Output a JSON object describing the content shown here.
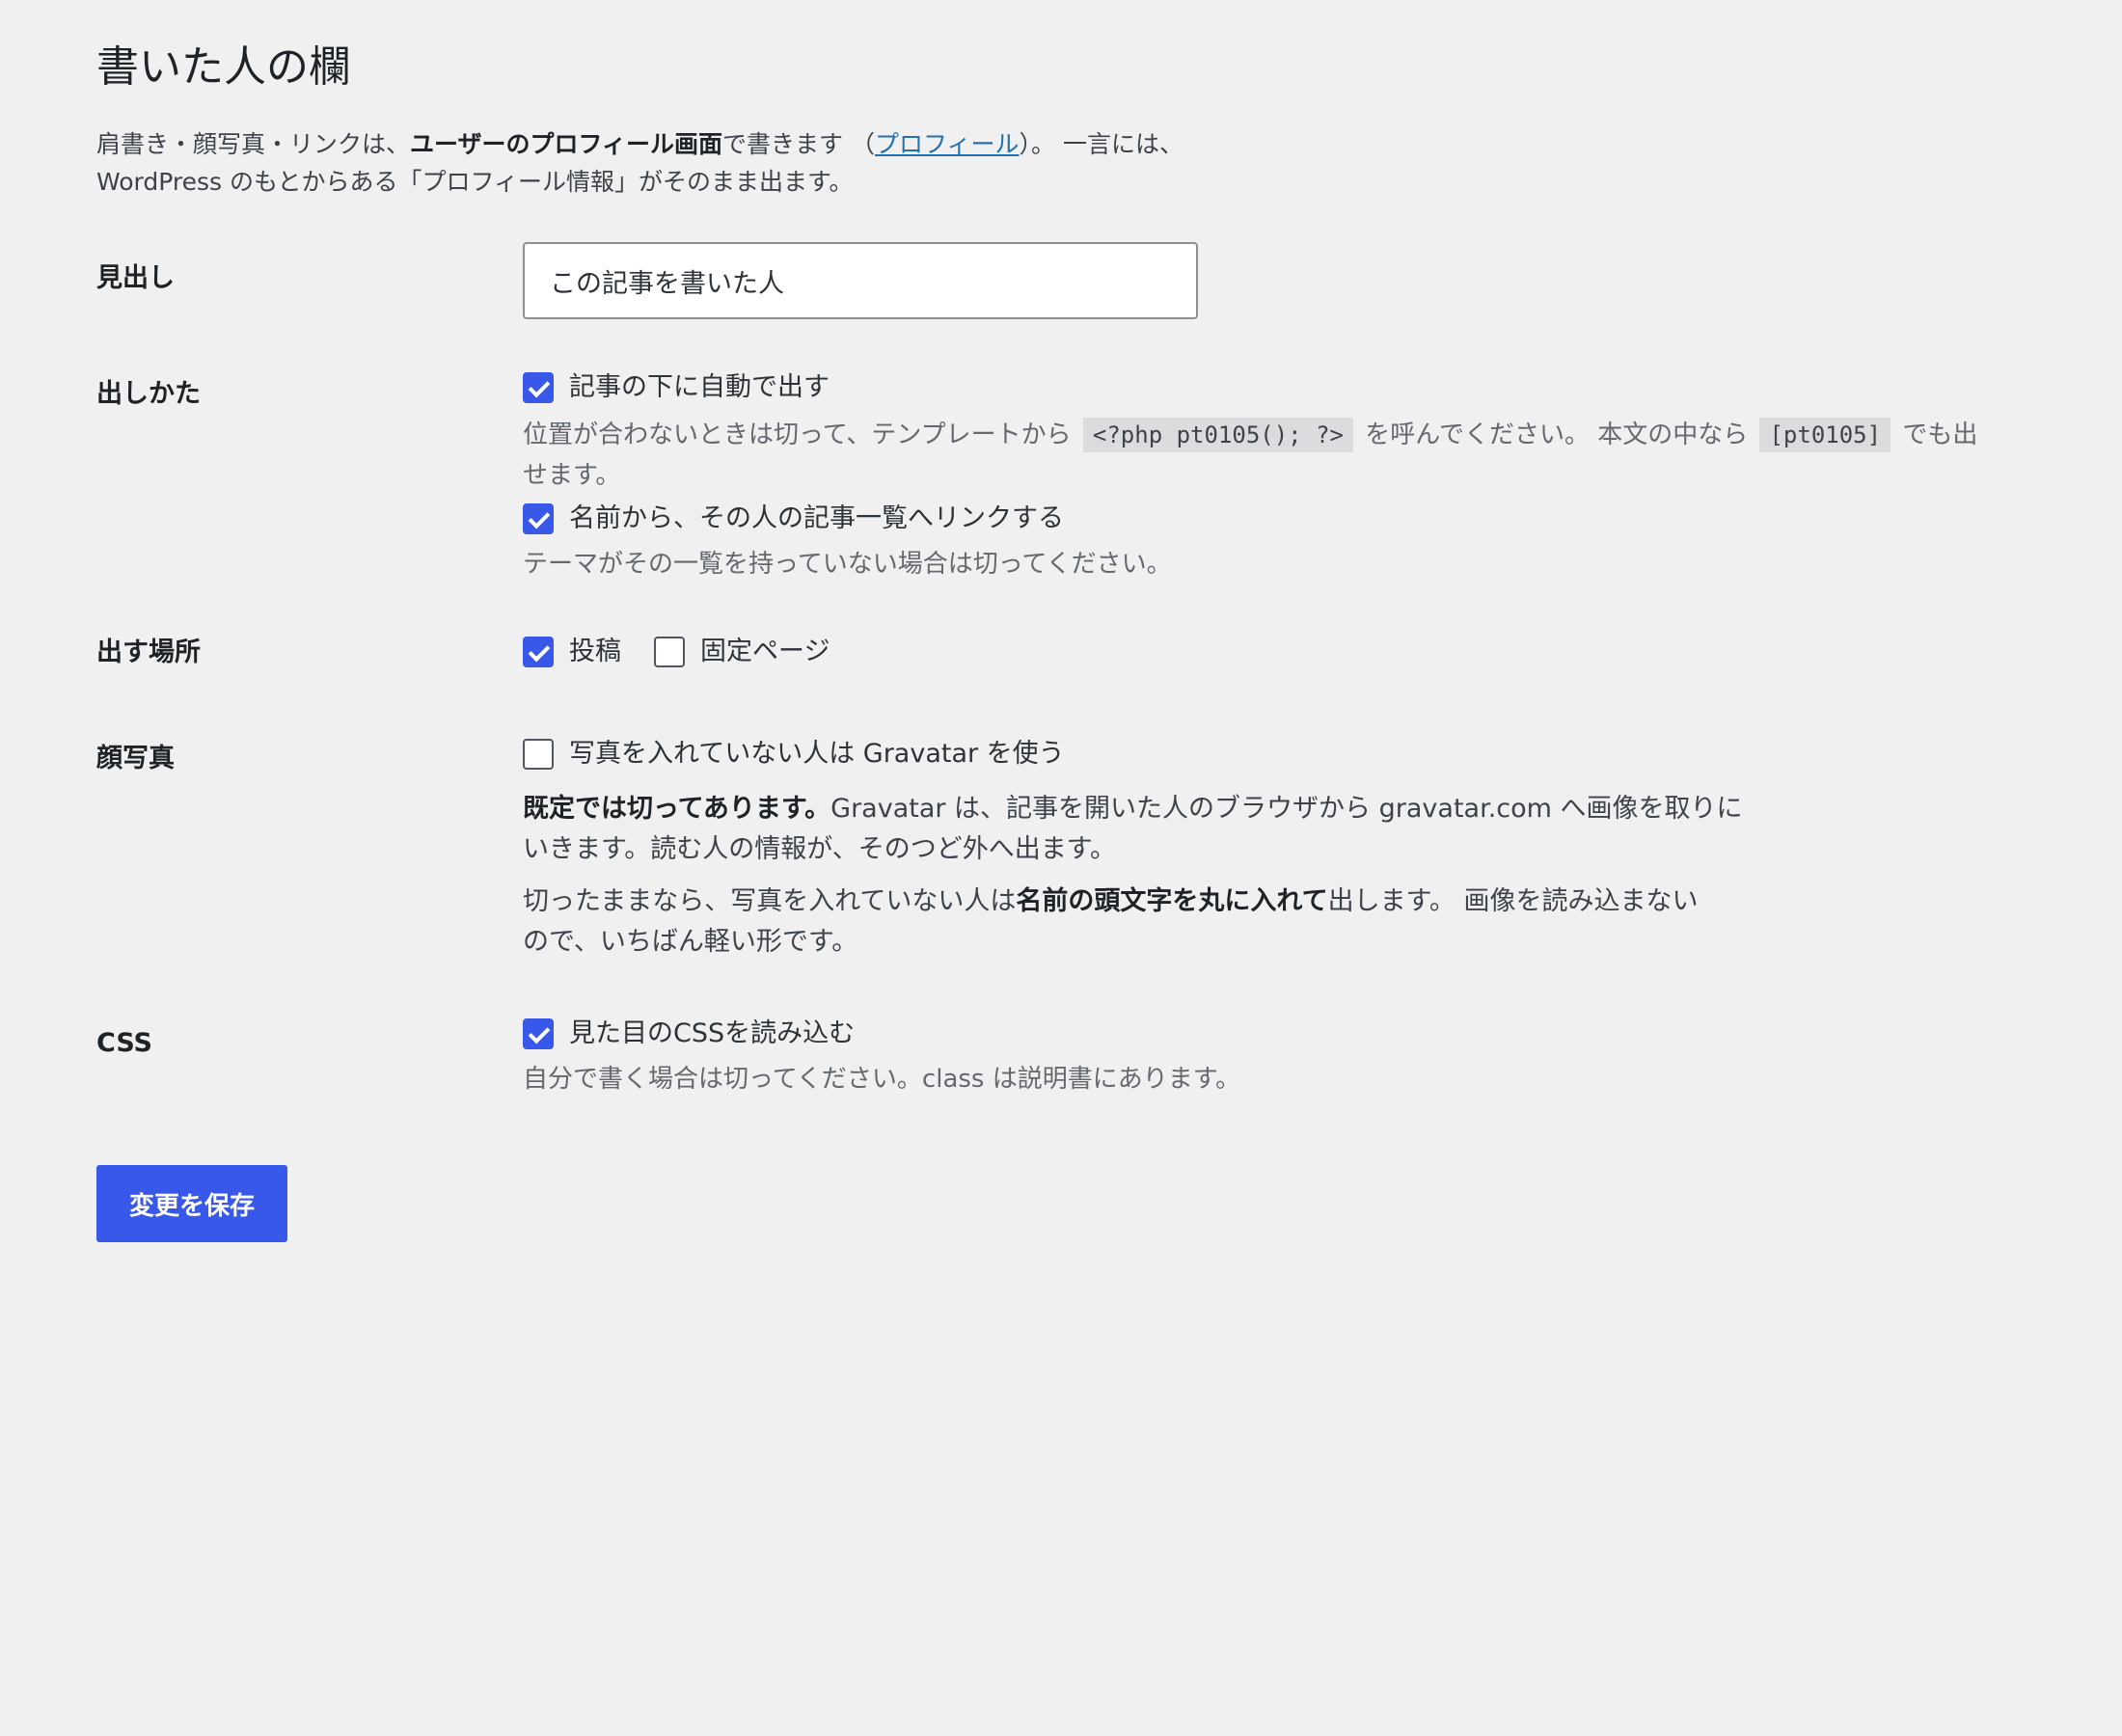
{
  "page_title": "書いた人の欄",
  "intro": {
    "part1": "肩書き・顔写真・リンクは、",
    "bold": "ユーザーのプロフィール画面",
    "part2": "で書きます （",
    "link": "プロフィール",
    "part3": "）。 一言には、",
    "line2": "WordPress のもとからある「プロフィール情報」がそのまま出ます。"
  },
  "heading_row": {
    "label": "見出し",
    "value": "この記事を書いた人"
  },
  "display_row": {
    "label": "出しかた",
    "auto_label": "記事の下に自動で出す",
    "auto_checked": true,
    "auto_desc_1": "位置が合わないときは切って、テンプレートから",
    "auto_code_1": "<?php pt0105(); ?>",
    "auto_desc_2": "を呼んでください。 本文の中なら",
    "auto_code_2": "[pt0105]",
    "auto_desc_3": "でも出",
    "auto_desc_4": "せます。",
    "link_label": "名前から、その人の記事一覧へリンクする",
    "link_checked": true,
    "link_desc": "テーマがその一覧を持っていない場合は切ってください。"
  },
  "location_row": {
    "label": "出す場所",
    "post_label": "投稿",
    "post_checked": true,
    "page_label": "固定ページ",
    "page_checked": false
  },
  "photo_row": {
    "label": "顔写真",
    "gravatar_label": "写真を入れていない人は Gravatar を使う",
    "gravatar_checked": false,
    "p1_bold": "既定では切ってあります。",
    "p1_line1": "Gravatar は、記事を開いた人のブラウザから gravatar.com へ画像を取りに",
    "p1_line2": "いきます。読む人の情報が、そのつど外へ出ます。",
    "p2_part1": "切ったままなら、写真を入れていない人は",
    "p2_bold": "名前の頭文字を丸に入れて",
    "p2_part2": "出します。 画像を読み込まない",
    "p2_line2": "ので、いちばん軽い形です。"
  },
  "css_row": {
    "label": "CSS",
    "css_label": "見た目のCSSを読み込む",
    "css_checked": true,
    "css_desc": "自分で書く場合は切ってください。class は説明書にあります。"
  },
  "save_button": "変更を保存",
  "colors": {
    "accent": "#3858e9",
    "link": "#2271b1",
    "background": "#f0f0f1"
  }
}
